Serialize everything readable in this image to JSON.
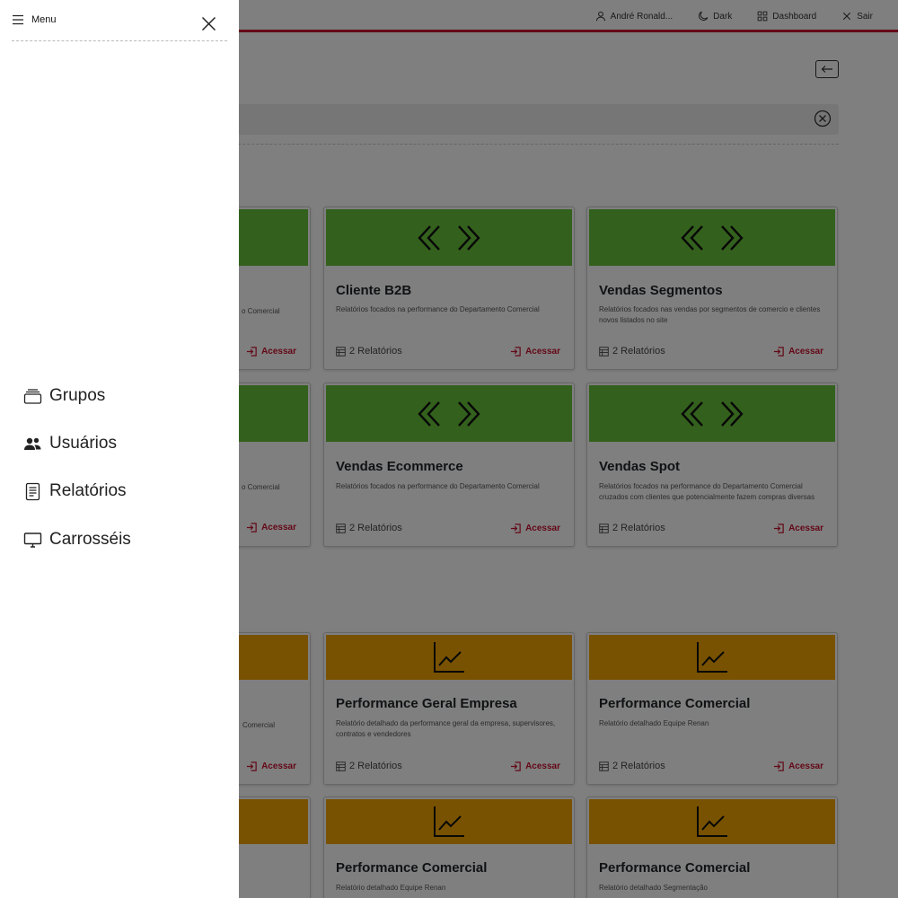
{
  "topbar": {
    "user_label": "André Ronald...",
    "dark_label": "Dark",
    "dashboard_label": "Dashboard",
    "logout_label": "Sair"
  },
  "drawer": {
    "title": "Menu",
    "items": [
      {
        "label": "Grupos",
        "icon": "stack-icon"
      },
      {
        "label": "Usuários",
        "icon": "users-icon"
      },
      {
        "label": "Relatórios",
        "icon": "document-icon"
      },
      {
        "label": "Carrosséis",
        "icon": "monitor-icon"
      }
    ]
  },
  "cards": [
    {
      "title": "",
      "desc": "o Comercial",
      "count": "",
      "access": "Acessar"
    },
    {
      "title": "Cliente B2B",
      "desc": "Relatórios focados na performance do Departamento Comercial",
      "count": "2 Relatórios",
      "access": "Acessar"
    },
    {
      "title": "Vendas Segmentos",
      "desc": "Relatórios focados nas vendas por segmentos de comercio e clientes novos listados no site",
      "count": "2 Relatórios",
      "access": "Acessar"
    },
    {
      "title": "",
      "desc": "o Comercial",
      "count": "",
      "access": "Acessar"
    },
    {
      "title": "Vendas Ecommerce",
      "desc": "Relatórios focados na performance do Departamento Comercial",
      "count": "2 Relatórios",
      "access": "Acessar"
    },
    {
      "title": "Vendas Spot",
      "desc": "Relatórios focados na performance do Departamento Comercial cruzados com clientes que potencialmente fazem compras diversas",
      "count": "2 Relatórios",
      "access": "Acessar"
    },
    {
      "title": "",
      "desc": "Comercial",
      "count": "",
      "access": "Acessar"
    },
    {
      "title": "Performance Geral Empresa",
      "desc": "Relatório detalhado da performance geral da empresa, supervisores, contratos e vendedores",
      "count": "2 Relatórios",
      "access": "Acessar"
    },
    {
      "title": "Performance Comercial",
      "desc": "Relatório detalhado Equipe Renan",
      "count": "2 Relatórios",
      "access": "Acessar"
    },
    {
      "title": "",
      "desc": "",
      "count": "",
      "access": ""
    },
    {
      "title": "Performance Comercial",
      "desc": "Relatório detalhado Equipe Renan",
      "count": "",
      "access": ""
    },
    {
      "title": "Performance Comercial",
      "desc": "Relatório detalhado Segmentação",
      "count": "",
      "access": ""
    }
  ],
  "colors": {
    "brand_red": "#c8102e",
    "header_green": "#67c23a",
    "header_orange": "#f0a500",
    "overlay": "rgba(0,0,0,0.5)"
  }
}
